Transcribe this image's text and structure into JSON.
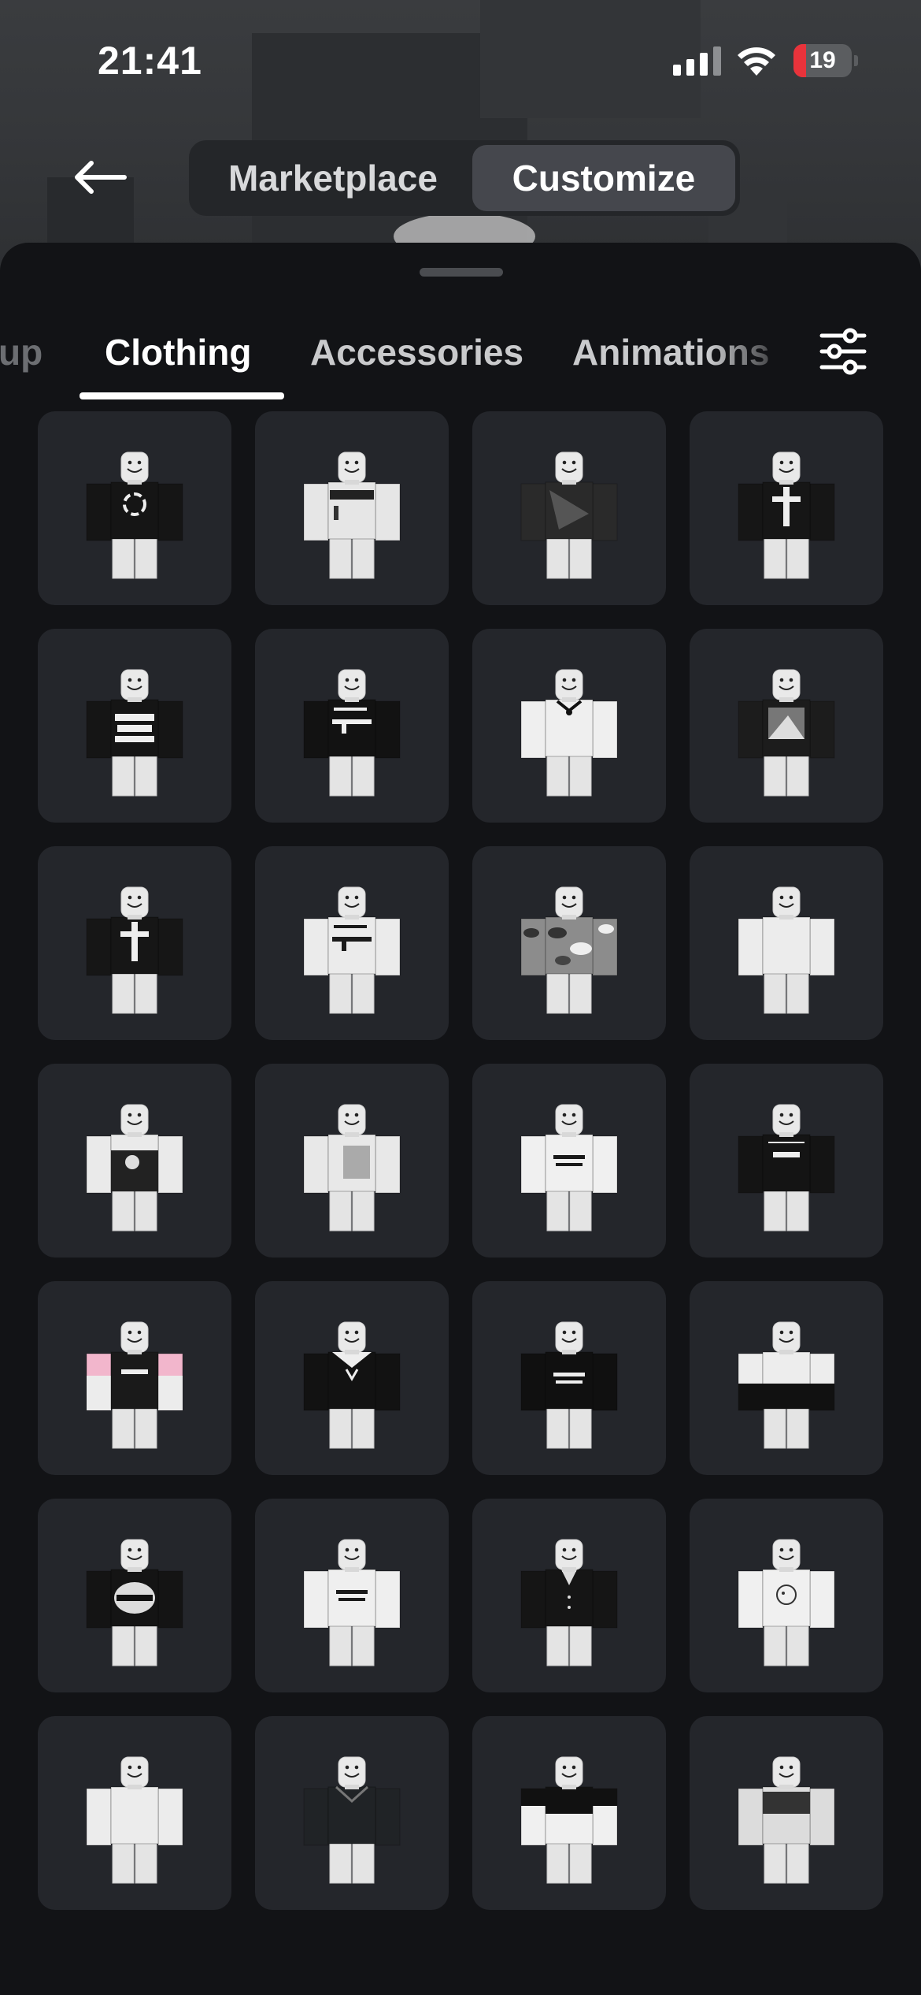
{
  "status_bar": {
    "time": "21:41",
    "battery": "19"
  },
  "header": {
    "back_icon": "arrow-left-icon",
    "segments": [
      {
        "label": "Marketplace",
        "selected": false
      },
      {
        "label": "Customize",
        "selected": true
      }
    ]
  },
  "tabs": {
    "items": [
      {
        "label": "up",
        "state": "partial"
      },
      {
        "label": "Clothing",
        "state": "active"
      },
      {
        "label": "Accessories",
        "state": "normal"
      },
      {
        "label": "Animations",
        "state": "partial"
      }
    ],
    "filter_icon": "sliders-filter-icon"
  },
  "colors": {
    "sheet_bg": "#121316",
    "card_bg": "#24262b",
    "active_segment": "#45474d",
    "battery_low": "#e8333b"
  },
  "items": [
    {
      "shirt": "#151515",
      "detail": "white-ring-logo"
    },
    {
      "shirt": "#e6e6e6",
      "detail": "black-band-print"
    },
    {
      "shirt": "#2a2a2a",
      "detail": "dark-graphic"
    },
    {
      "shirt": "#161616",
      "detail": "white-cross"
    },
    {
      "shirt": "#151515",
      "detail": "rock-print"
    },
    {
      "shirt": "#121212",
      "detail": "rifle-print"
    },
    {
      "shirt": "#efefef",
      "detail": "bow-collar"
    },
    {
      "shirt": "#1c1c1c",
      "detail": "photo-print"
    },
    {
      "shirt": "#161616",
      "detail": "white-cross"
    },
    {
      "shirt": "#ebebeb",
      "detail": "rifle-print"
    },
    {
      "shirt": "#8c8c8c",
      "detail": "camo"
    },
    {
      "shirt": "#ececec",
      "detail": "plain"
    },
    {
      "shirt": "#eaeaea",
      "detail": "black-graphic"
    },
    {
      "shirt": "#e8e8e8",
      "detail": "grey-photo"
    },
    {
      "shirt": "#f0f0f0",
      "detail": "text-print"
    },
    {
      "shirt": "#141414",
      "detail": "swat-print"
    },
    {
      "shirt": "#1a1a1a",
      "detail": "pink-sleeves"
    },
    {
      "shirt": "#121212",
      "detail": "white-collar"
    },
    {
      "shirt": "#101010",
      "detail": "text-print"
    },
    {
      "shirt": "#ededed",
      "detail": "black-bottom"
    },
    {
      "shirt": "#141414",
      "detail": "mouth-print"
    },
    {
      "shirt": "#efefef",
      "detail": "text-print"
    },
    {
      "shirt": "#151515",
      "detail": "suit"
    },
    {
      "shirt": "#f0f0f0",
      "detail": "small-drawing"
    },
    {
      "shirt": "#ececec",
      "detail": "plain"
    },
    {
      "shirt": "#202326",
      "detail": "dark-hoodie"
    },
    {
      "shirt": "#f0f0f0",
      "detail": "black-top"
    },
    {
      "shirt": "#dcdcdc",
      "detail": "dark-band"
    }
  ]
}
